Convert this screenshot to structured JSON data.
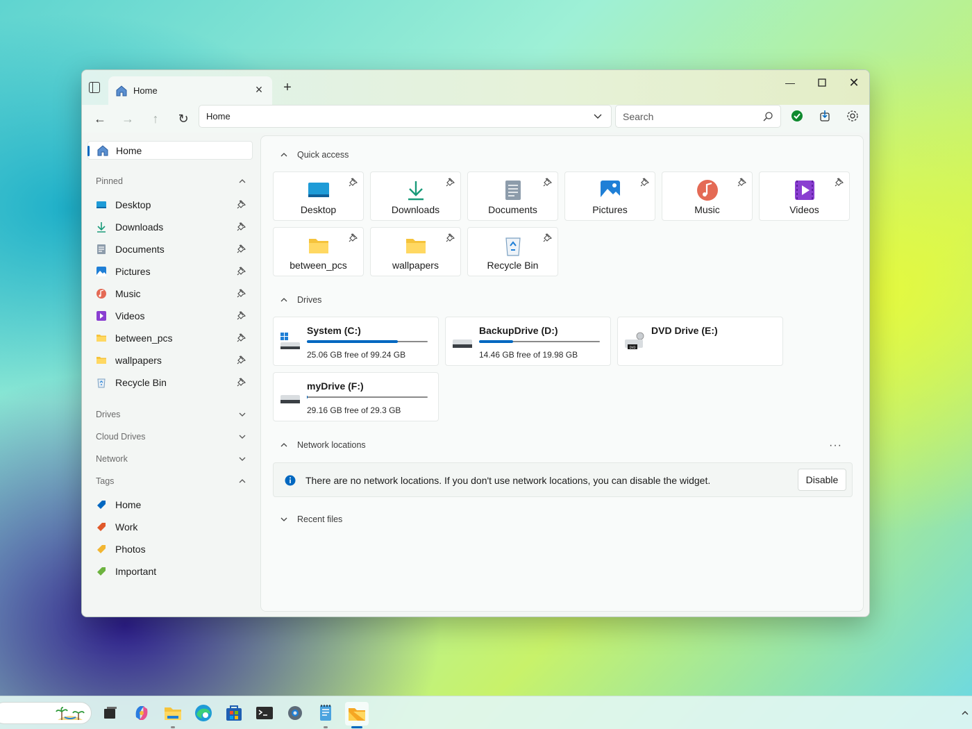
{
  "tab": {
    "label": "Home"
  },
  "address": {
    "path": "Home"
  },
  "search": {
    "placeholder": "Search"
  },
  "sidebar": {
    "home_label": "Home",
    "pinned_title": "Pinned",
    "pinned_items": [
      {
        "label": "Desktop",
        "icon": "desktop-icon"
      },
      {
        "label": "Downloads",
        "icon": "download-icon"
      },
      {
        "label": "Documents",
        "icon": "document-icon"
      },
      {
        "label": "Pictures",
        "icon": "picture-icon"
      },
      {
        "label": "Music",
        "icon": "music-icon"
      },
      {
        "label": "Videos",
        "icon": "video-icon"
      },
      {
        "label": "between_pcs",
        "icon": "folder-icon"
      },
      {
        "label": "wallpapers",
        "icon": "folder-icon"
      },
      {
        "label": "Recycle Bin",
        "icon": "recycle-bin-icon"
      }
    ],
    "drives_title": "Drives",
    "cloud_title": "Cloud Drives",
    "network_title": "Network",
    "tags_title": "Tags",
    "tags": [
      {
        "label": "Home",
        "color": "#0067c0"
      },
      {
        "label": "Work",
        "color": "#e0592a"
      },
      {
        "label": "Photos",
        "color": "#f2b632"
      },
      {
        "label": "Important",
        "color": "#6cb33f"
      }
    ]
  },
  "quick_access": {
    "title": "Quick access",
    "items": [
      {
        "label": "Desktop",
        "icon": "desktop-icon"
      },
      {
        "label": "Downloads",
        "icon": "download-icon"
      },
      {
        "label": "Documents",
        "icon": "document-icon"
      },
      {
        "label": "Pictures",
        "icon": "picture-icon"
      },
      {
        "label": "Music",
        "icon": "music-icon"
      },
      {
        "label": "Videos",
        "icon": "video-icon"
      },
      {
        "label": "between_pcs",
        "icon": "folder-icon"
      },
      {
        "label": "wallpapers",
        "icon": "folder-icon"
      },
      {
        "label": "Recycle Bin",
        "icon": "recycle-bin-icon"
      }
    ]
  },
  "drives": {
    "title": "Drives",
    "items": [
      {
        "name": "System (C:)",
        "free": "25.06 GB free of 99.24 GB",
        "used_fraction": 0.75,
        "icon": "system-drive-icon"
      },
      {
        "name": "BackupDrive (D:)",
        "free": "14.46 GB free of 19.98 GB",
        "used_fraction": 0.28,
        "icon": "hard-drive-icon"
      },
      {
        "name": "DVD Drive (E:)",
        "free": "",
        "used_fraction": null,
        "icon": "dvd-drive-icon"
      },
      {
        "name": "myDrive (F:)",
        "free": "29.16 GB free of 29.3 GB",
        "used_fraction": 0.005,
        "icon": "hard-drive-icon"
      }
    ]
  },
  "network": {
    "title": "Network locations",
    "message": "There are no network locations. If you don't use network locations, you can disable the widget.",
    "disable_label": "Disable",
    "more": "···"
  },
  "recent": {
    "title": "Recent files"
  },
  "colors": {
    "accent": "#0067c0",
    "status_ok": "#0f8a2f"
  }
}
